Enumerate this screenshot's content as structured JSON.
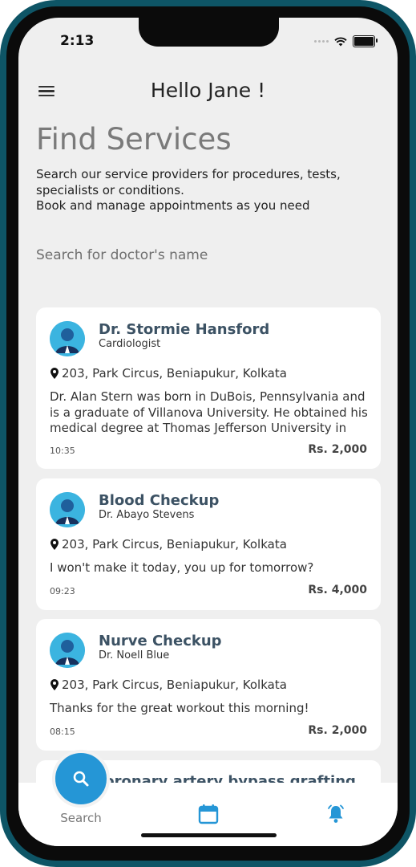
{
  "status_bar": {
    "time": "2:13"
  },
  "header": {
    "greeting": "Hello Jane !"
  },
  "page": {
    "title": "Find Services",
    "subtitle_line1": "Search our service providers for procedures, tests, specialists or conditions.",
    "subtitle_line2": "Book and manage appointments as you need"
  },
  "search": {
    "placeholder": "Search for doctor's name",
    "value": ""
  },
  "cards": [
    {
      "title": "Dr. Stormie Hansford",
      "subtitle": "Cardiologist",
      "location": "203, Park Circus, Beniapukur, Kolkata",
      "description": "Dr. Alan Stern was born in DuBois, Pennsylvania and is a graduate of Villanova University. He obtained his medical degree at Thomas Jefferson University in",
      "time": "10:35",
      "price": "Rs. 2,000"
    },
    {
      "title": "Blood Checkup",
      "subtitle": "Dr. Abayo Stevens",
      "location": "203, Park Circus, Beniapukur, Kolkata",
      "description": "I won't make it today, you up for tomorrow?",
      "time": "09:23",
      "price": "Rs. 4,000"
    },
    {
      "title": "Nurve Checkup",
      "subtitle": "Dr. Noell Blue",
      "location": "203, Park Circus, Beniapukur, Kolkata",
      "description": "Thanks for the great workout this morning!",
      "time": "08:15",
      "price": "Rs. 2,000"
    },
    {
      "title": "Coronary artery bypass grafting"
    }
  ],
  "tabbar": {
    "search_label": "Search",
    "accent_color": "#2596d6",
    "icons": [
      "search-icon",
      "calendar-icon",
      "notification-bell-icon"
    ]
  }
}
